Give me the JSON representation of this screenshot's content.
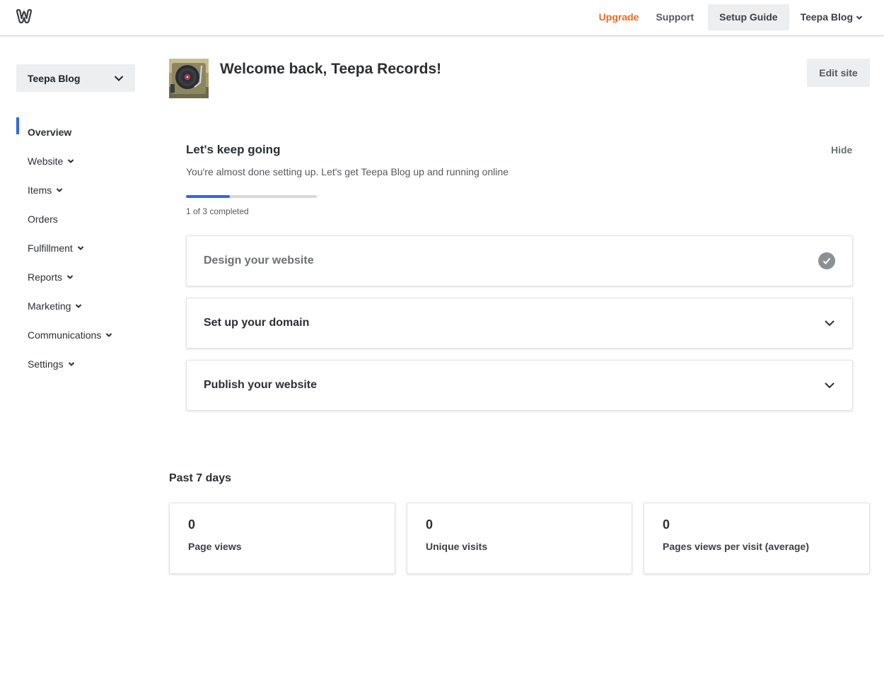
{
  "topbar": {
    "logo_icon": "weebly-logo-icon",
    "upgrade_label": "Upgrade",
    "support_label": "Support",
    "setup_guide_label": "Setup Guide",
    "site_menu_label": "Teepa Blog",
    "upgrade_color": "#f26a21"
  },
  "sidebar": {
    "site_selector": "Teepa Blog",
    "items": [
      {
        "label": "Overview",
        "active": true,
        "has_chevron": false
      },
      {
        "label": "Website",
        "has_chevron": true
      },
      {
        "label": "Items",
        "has_chevron": true
      },
      {
        "label": "Orders",
        "has_chevron": false
      },
      {
        "label": "Fulfillment",
        "has_chevron": true
      },
      {
        "label": "Reports",
        "has_chevron": true
      },
      {
        "label": "Marketing",
        "has_chevron": true
      },
      {
        "label": "Communications",
        "has_chevron": true
      },
      {
        "label": "Settings",
        "has_chevron": true
      }
    ],
    "accent_color": "#3068e0"
  },
  "header": {
    "welcome": "Welcome back, Teepa Records!",
    "edit_site_label": "Edit site",
    "avatar_icon": "record-player-avatar"
  },
  "setup": {
    "title": "Let's keep going",
    "hide_label": "Hide",
    "subtitle": "You're almost done setting up. Let's get Teepa Blog up and running online",
    "progress_fraction": 0.333,
    "progress_text": "1 of 3 completed",
    "tasks": [
      {
        "label": "Design your website",
        "completed": true,
        "icon": "check-circle-icon"
      },
      {
        "label": "Set up your domain",
        "completed": false,
        "icon": "chevron-down-icon"
      },
      {
        "label": "Publish your website",
        "completed": false,
        "icon": "chevron-down-icon"
      }
    ]
  },
  "stats": {
    "title": "Past 7 days",
    "cards": [
      {
        "value": "0",
        "label": "Page views"
      },
      {
        "value": "0",
        "label": "Unique visits"
      },
      {
        "value": "0",
        "label": "Pages views per visit (average)"
      }
    ]
  }
}
